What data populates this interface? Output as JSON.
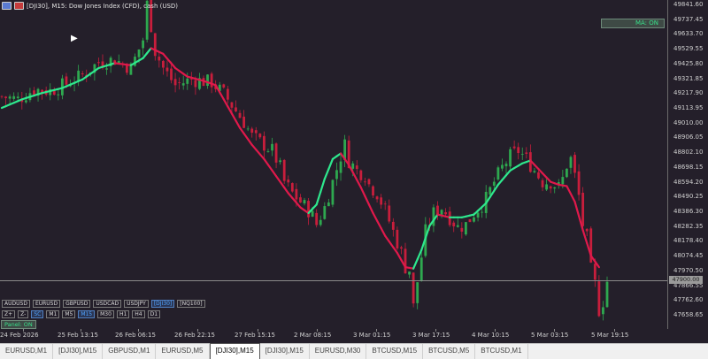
{
  "title": "[DJI30], M15:  Dow Jones Index (CFD), cash (USD)",
  "ma_badge": "MA: ON",
  "current_price": "47900.00",
  "panel_badge": "Panel: ON",
  "colors": {
    "background": "#241f2a",
    "ma_up": "#2ee88e",
    "ma_down": "#e0194b",
    "bull": "#2ea84f",
    "bear": "#c81e3c",
    "active_button": "#4fa3ff"
  },
  "symbol_buttons": [
    {
      "label": "AUDUSD",
      "active": false
    },
    {
      "label": "EURUSD",
      "active": false
    },
    {
      "label": "GBPUSD",
      "active": false
    },
    {
      "label": "USDCAD",
      "active": false
    },
    {
      "label": "USDJPY",
      "active": false
    },
    {
      "label": "[DJI30]",
      "active": true
    },
    {
      "label": "[NQ100]",
      "active": false
    }
  ],
  "tf_buttons": [
    {
      "label": "Z+",
      "active": false
    },
    {
      "label": "Z-",
      "active": false
    },
    {
      "label": "SC",
      "active": true
    },
    {
      "label": "M1",
      "active": false
    },
    {
      "label": "M5",
      "active": false
    },
    {
      "label": "M15",
      "active": true
    },
    {
      "label": "M30",
      "active": false
    },
    {
      "label": "H1",
      "active": false
    },
    {
      "label": "H4",
      "active": false
    },
    {
      "label": "D1",
      "active": false
    }
  ],
  "tabs": [
    {
      "label": "EURUSD,M1",
      "active": false
    },
    {
      "label": "[DJI30],M15",
      "active": false
    },
    {
      "label": "GBPUSD,M1",
      "active": false
    },
    {
      "label": "EURUSD,M5",
      "active": false
    },
    {
      "label": "[DJI30],M15",
      "active": true
    },
    {
      "label": "[DJI30],M15",
      "active": false
    },
    {
      "label": "EURUSD,M30",
      "active": false
    },
    {
      "label": "BTCUSD,M15",
      "active": false
    },
    {
      "label": "BTCUSD,M5",
      "active": false
    },
    {
      "label": "BTCUSD,M1",
      "active": false
    }
  ],
  "chart_data": {
    "type": "candlestick",
    "symbol": "[DJI30]",
    "timeframe": "M15",
    "price_ticks": [
      "49841.60",
      "49737.45",
      "49633.70",
      "49529.55",
      "49425.80",
      "49321.85",
      "49217.90",
      "49113.95",
      "49010.00",
      "48906.05",
      "48802.10",
      "48698.15",
      "48594.20",
      "48490.25",
      "48386.30",
      "48282.35",
      "48178.40",
      "48074.45",
      "47970.50",
      "47866.55",
      "47762.60",
      "47658.65"
    ],
    "price_ticks_num": [
      49841.6,
      49737.45,
      49633.7,
      49529.55,
      49425.8,
      49321.85,
      49217.9,
      49113.95,
      49010,
      48906.05,
      48802.1,
      48698.15,
      48594.2,
      48490.25,
      48386.3,
      48282.35,
      48178.4,
      48074.45,
      47970.5,
      47866.55,
      47762.6,
      47658.65
    ],
    "time_ticks": [
      "24 Feb 2026",
      "25 Feb 13:15",
      "26 Feb 06:15",
      "26 Feb 22:15",
      "27 Feb 15:15",
      "2 Mar 08:15",
      "3 Mar 01:15",
      "3 Mar 17:15",
      "4 Mar 10:15",
      "5 Mar 03:15",
      "5 Mar 19:15"
    ],
    "ylim": [
      47600,
      49900
    ],
    "current_price": 47900.0,
    "close_path": [
      [
        0,
        49200
      ],
      [
        4,
        49180
      ],
      [
        8,
        49250
      ],
      [
        12,
        49240
      ],
      [
        16,
        49290
      ],
      [
        20,
        49350
      ],
      [
        24,
        49440
      ],
      [
        28,
        49460
      ],
      [
        32,
        49400
      ],
      [
        35,
        49600
      ],
      [
        36,
        49850
      ],
      [
        37,
        49700
      ],
      [
        38,
        49520
      ],
      [
        40,
        49400
      ],
      [
        43,
        49280
      ],
      [
        47,
        49320
      ],
      [
        52,
        49300
      ],
      [
        55,
        49220
      ],
      [
        58,
        49100
      ],
      [
        60,
        49020
      ],
      [
        62,
        48920
      ],
      [
        65,
        48860
      ],
      [
        67,
        48820
      ],
      [
        69,
        48700
      ],
      [
        70,
        48600
      ],
      [
        72,
        48520
      ],
      [
        74,
        48460
      ],
      [
        76,
        48400
      ],
      [
        77,
        48360
      ],
      [
        78,
        48300
      ],
      [
        80,
        48420
      ],
      [
        82,
        48600
      ],
      [
        84,
        48780
      ],
      [
        85,
        48860
      ],
      [
        86,
        48750
      ],
      [
        88,
        48680
      ],
      [
        90,
        48650
      ],
      [
        91,
        48580
      ],
      [
        93,
        48520
      ],
      [
        95,
        48400
      ],
      [
        97,
        48250
      ],
      [
        99,
        48100
      ],
      [
        100,
        48000
      ],
      [
        101,
        47980
      ],
      [
        102,
        47720
      ],
      [
        103,
        47900
      ],
      [
        105,
        48250
      ],
      [
        107,
        48380
      ],
      [
        109,
        48420
      ],
      [
        111,
        48350
      ],
      [
        113,
        48280
      ],
      [
        115,
        48300
      ],
      [
        117,
        48380
      ],
      [
        119,
        48440
      ],
      [
        120,
        48480
      ],
      [
        122,
        48600
      ],
      [
        124,
        48700
      ],
      [
        126,
        48780
      ],
      [
        128,
        48820
      ],
      [
        130,
        48760
      ],
      [
        132,
        48680
      ],
      [
        134,
        48600
      ],
      [
        136,
        48600
      ],
      [
        138,
        48560
      ],
      [
        139,
        48620
      ],
      [
        140,
        48720
      ],
      [
        141,
        48760
      ],
      [
        142,
        48640
      ],
      [
        143,
        48500
      ],
      [
        144,
        48300
      ],
      [
        145,
        48200
      ],
      [
        146,
        47980
      ],
      [
        147,
        47880
      ],
      [
        148,
        47700
      ],
      [
        149,
        47760
      ],
      [
        150,
        47900
      ]
    ],
    "ma_path": [
      [
        0,
        49120
      ],
      [
        5,
        49180
      ],
      [
        10,
        49225
      ],
      [
        15,
        49260
      ],
      [
        20,
        49320
      ],
      [
        24,
        49400
      ],
      [
        28,
        49435
      ],
      [
        32,
        49420
      ],
      [
        35,
        49470
      ],
      [
        37,
        49540
      ],
      [
        40,
        49500
      ],
      [
        43,
        49400
      ],
      [
        46,
        49340
      ],
      [
        50,
        49310
      ],
      [
        53,
        49280
      ],
      [
        56,
        49130
      ],
      [
        59,
        48980
      ],
      [
        62,
        48860
      ],
      [
        65,
        48760
      ],
      [
        68,
        48640
      ],
      [
        71,
        48520
      ],
      [
        74,
        48420
      ],
      [
        76,
        48380
      ],
      [
        78,
        48440
      ],
      [
        80,
        48620
      ],
      [
        82,
        48760
      ],
      [
        84,
        48800
      ],
      [
        86,
        48720
      ],
      [
        89,
        48560
      ],
      [
        92,
        48380
      ],
      [
        95,
        48220
      ],
      [
        98,
        48100
      ],
      [
        100,
        48000
      ],
      [
        102,
        47990
      ],
      [
        104,
        48120
      ],
      [
        106,
        48290
      ],
      [
        108,
        48370
      ],
      [
        111,
        48350
      ],
      [
        114,
        48350
      ],
      [
        117,
        48370
      ],
      [
        120,
        48450
      ],
      [
        123,
        48580
      ],
      [
        126,
        48680
      ],
      [
        129,
        48730
      ],
      [
        131,
        48750
      ],
      [
        133,
        48690
      ],
      [
        136,
        48600
      ],
      [
        138,
        48580
      ],
      [
        140,
        48570
      ],
      [
        142,
        48460
      ],
      [
        144,
        48260
      ],
      [
        146,
        48080
      ],
      [
        148,
        48000
      ]
    ],
    "ma_colors": {
      "rising": "#2ee88e",
      "falling": "#e0194b"
    },
    "ma_label": "MA"
  }
}
